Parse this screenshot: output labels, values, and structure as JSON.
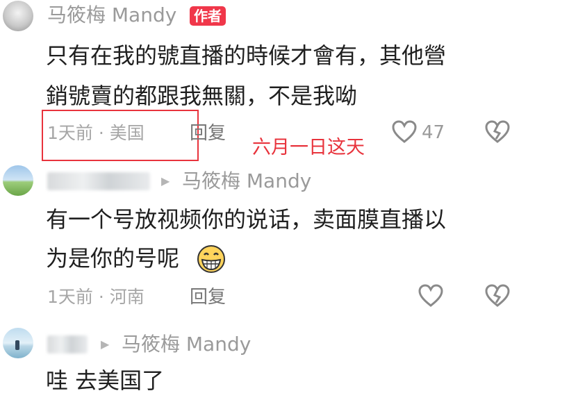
{
  "comments": [
    {
      "author": "马筱梅 Mandy",
      "badge": "作者",
      "text_lines": [
        "只有在我的號直播的時候才會有，其他營",
        "銷號賣的都跟我無關，不是我呦"
      ],
      "time_location": "1天前 · 美国",
      "reply_label": "回复",
      "likes": "47",
      "annotation": "六月一日这天"
    },
    {
      "reply_to": "马筱梅 Mandy",
      "text_lines": [
        "有一个号放视频你的说话，卖面膜直播以",
        "为是你的号呢"
      ],
      "emoji": "grinning-face",
      "time_location": "1天前 · 河南",
      "reply_label": "回复"
    },
    {
      "reply_to": "马筱梅 Mandy",
      "text_lines": [
        "哇 去美国了"
      ]
    }
  ],
  "colors": {
    "accent_red": "#e8333c",
    "badge_red": "#f0374a",
    "secondary_text": "#9a9a9a"
  }
}
